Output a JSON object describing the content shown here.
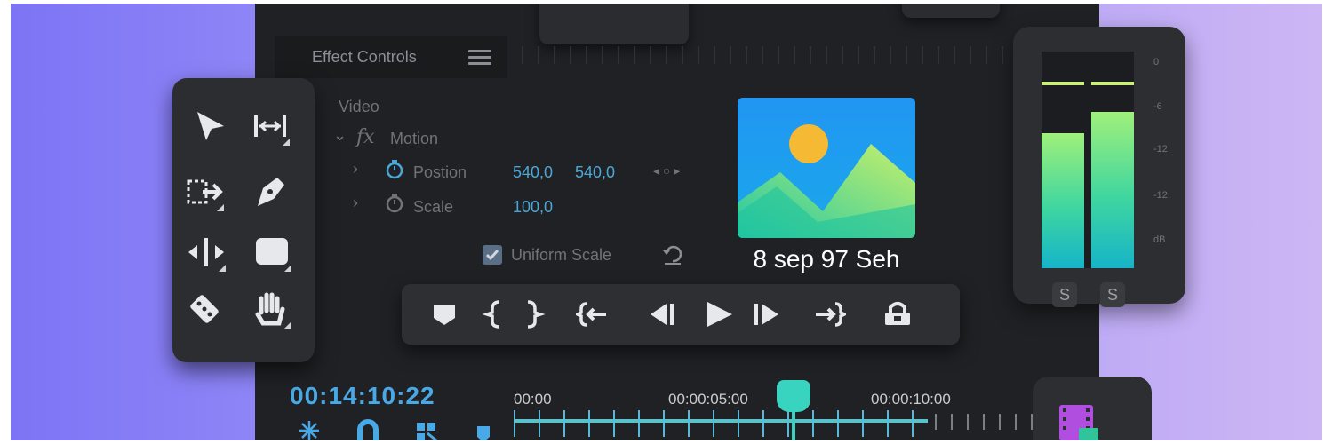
{
  "effect_controls": {
    "title": "Effect Controls",
    "section": "Video",
    "fx_label": "fx",
    "motion": "Motion",
    "position": {
      "label": "Postion",
      "x": "540,0",
      "y": "540,0"
    },
    "scale": {
      "label": "Scale",
      "value": "100,0"
    },
    "uniform_scale": {
      "label": "Uniform Scale",
      "checked": true
    }
  },
  "preview": {
    "caption": "8 sep 97 Seh",
    "icon": "image-icon"
  },
  "audio_meter": {
    "db_labels": [
      "0",
      "-6",
      "-12",
      "-12",
      "dB"
    ],
    "levels": [
      0.62,
      0.72
    ],
    "solo_left": "S",
    "solo_right": "S",
    "colors": {
      "top": "#9ff07a",
      "bottom": "#16b4c8"
    }
  },
  "timeline": {
    "timecode": "00:14:10:22",
    "marks": [
      "00:00",
      "00:00:05:00",
      "00:00:10:00"
    ]
  },
  "colors": {
    "accent": "#48a9e6",
    "playhead": "#39d4c0"
  }
}
